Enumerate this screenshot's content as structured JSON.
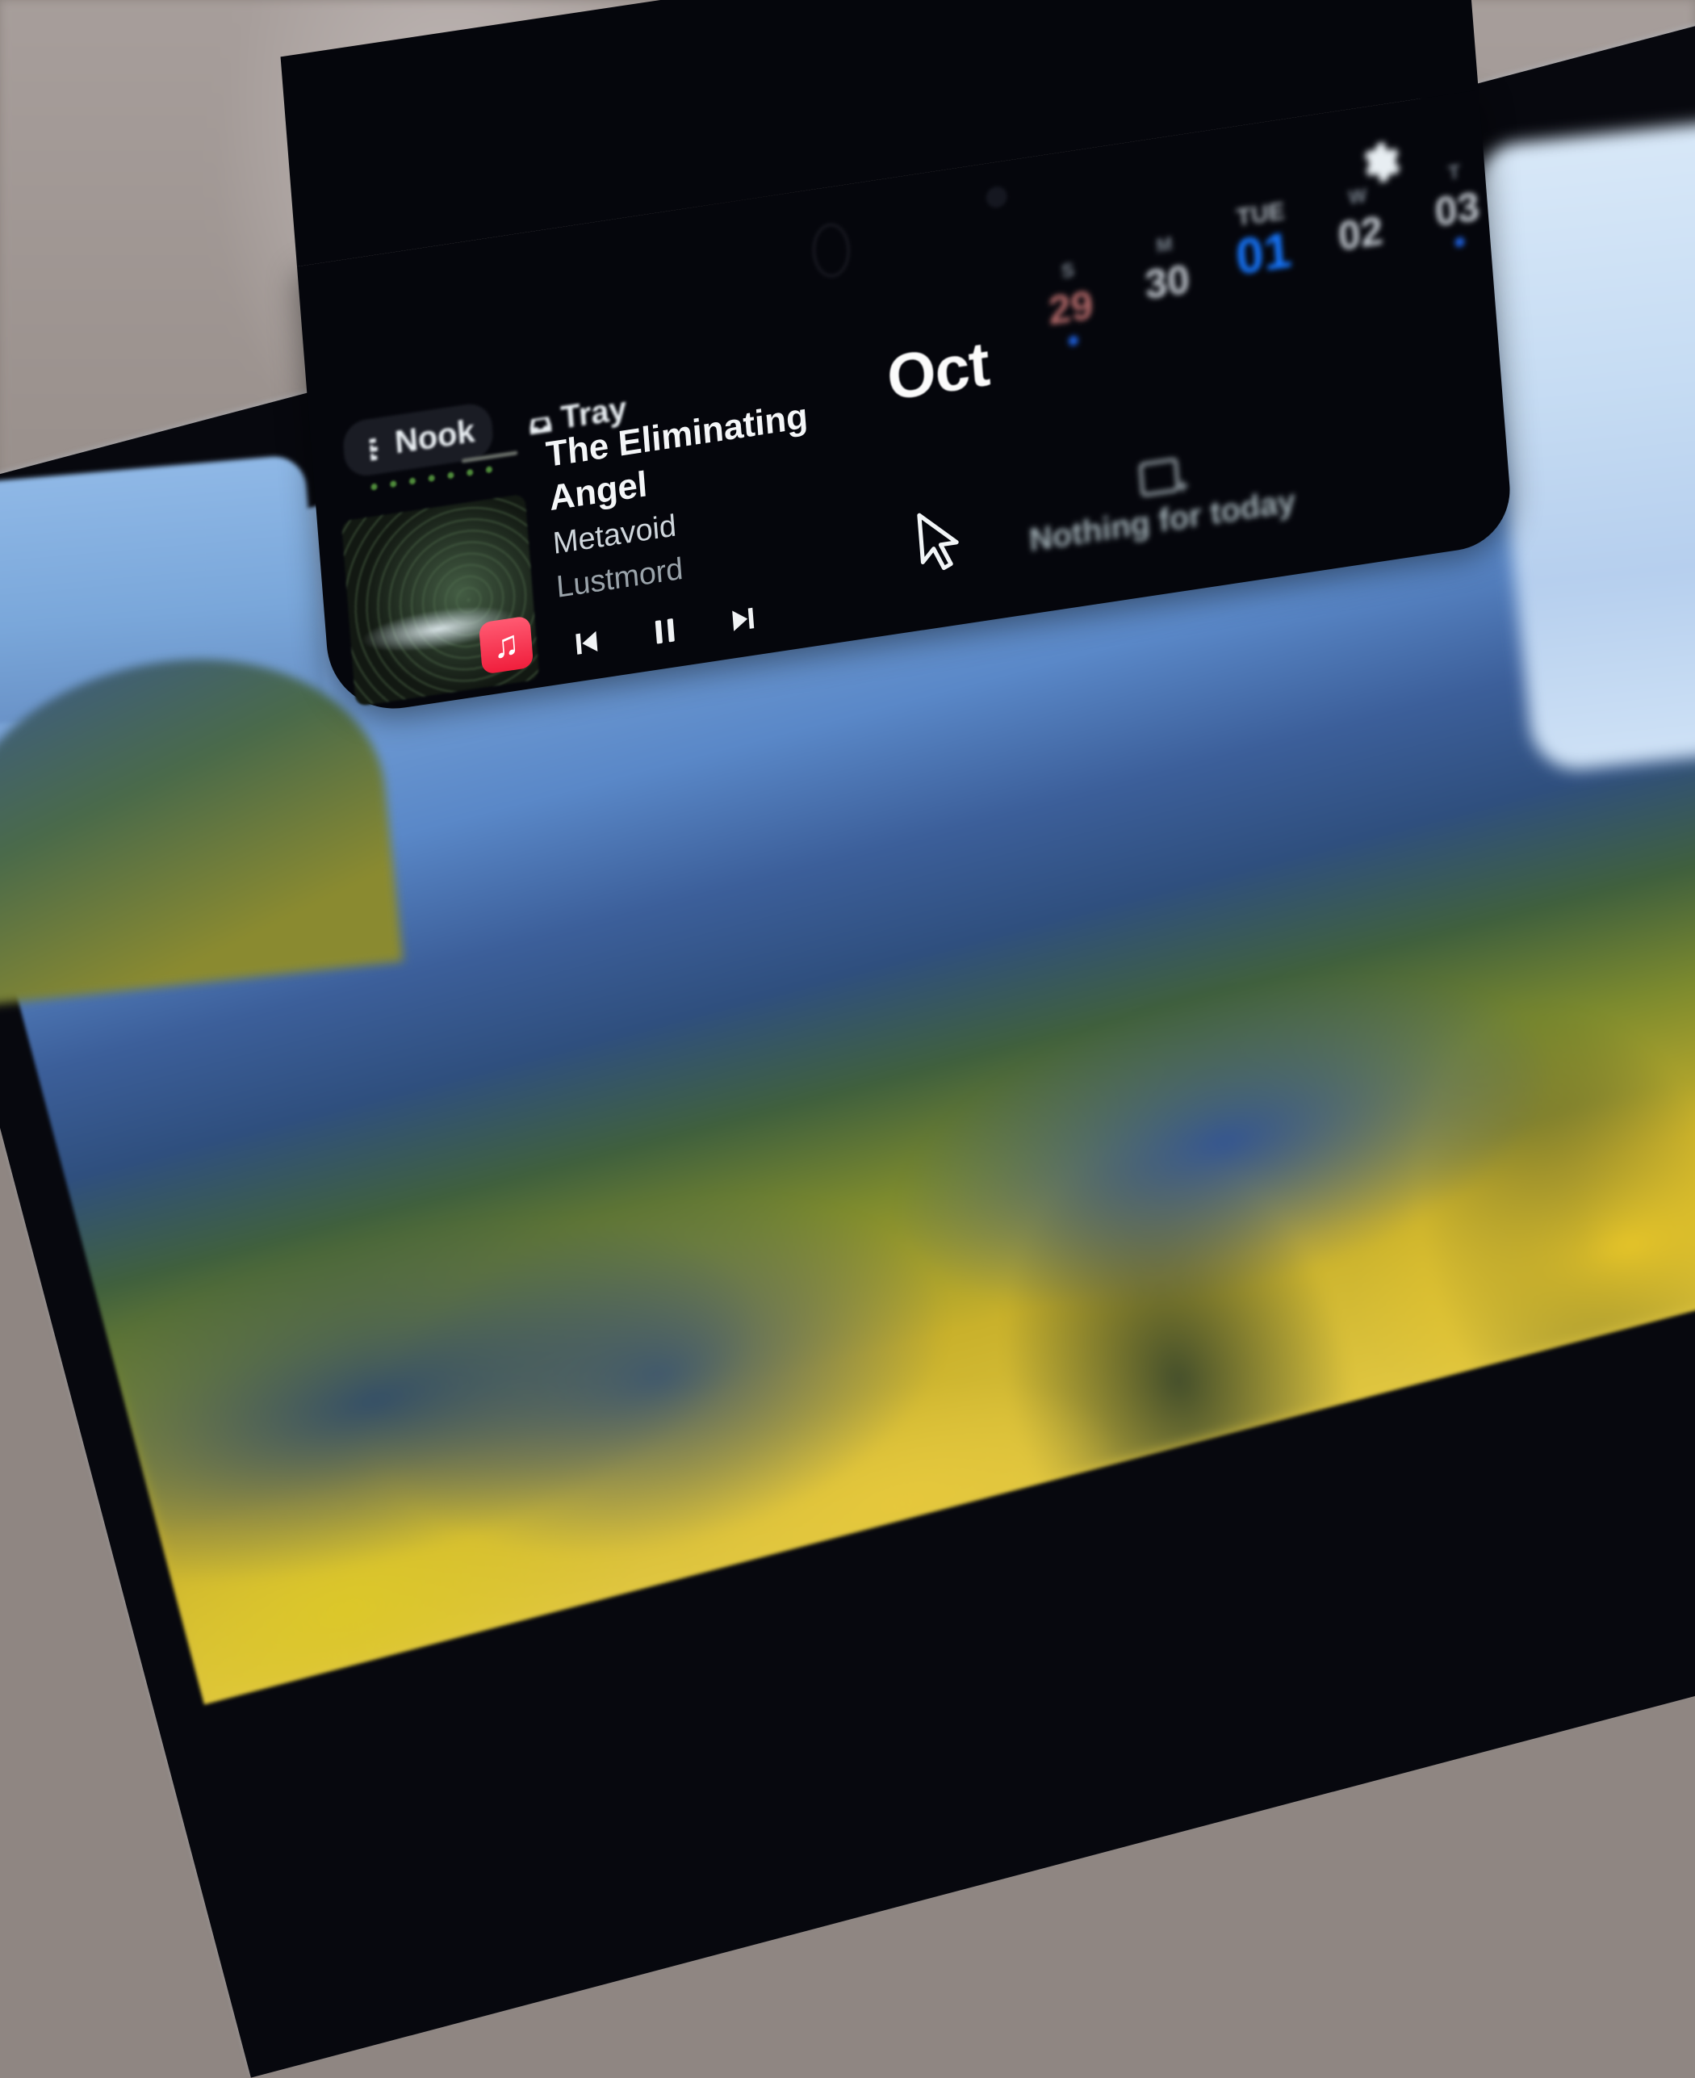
{
  "widget": {
    "tabs": [
      {
        "label": "Nook",
        "icon": "nook-icon",
        "active": true
      },
      {
        "label": "Tray",
        "icon": "tray-icon",
        "active": false
      }
    ],
    "settings_icon": "gear-icon"
  },
  "now_playing": {
    "title": "The Eliminating Angel",
    "album": "Metavoid",
    "artist": "Lustmord",
    "source_app": "Music",
    "source_icon": "music-note-icon",
    "controls": {
      "previous": "previous-track-icon",
      "play_pause": "pause-icon",
      "next": "next-track-icon"
    },
    "state": "playing"
  },
  "calendar": {
    "month": "Oct",
    "days": [
      {
        "dow": "S",
        "date": "29",
        "weekend": true,
        "today": false,
        "has_event": true
      },
      {
        "dow": "M",
        "date": "30",
        "weekend": false,
        "today": false,
        "has_event": false
      },
      {
        "dow": "TUE",
        "date": "01",
        "weekend": false,
        "today": true,
        "has_event": false
      },
      {
        "dow": "W",
        "date": "02",
        "weekend": false,
        "today": false,
        "has_event": false
      },
      {
        "dow": "T",
        "date": "03",
        "weekend": false,
        "today": false,
        "has_event": true
      }
    ],
    "empty_message": "Nothing for today",
    "empty_icon": "calendar-add-icon"
  },
  "colors": {
    "panel": "#05060c",
    "today_accent": "#1677ff",
    "event_dot": "#1e5ed8",
    "music_app": "#f01e3c"
  }
}
